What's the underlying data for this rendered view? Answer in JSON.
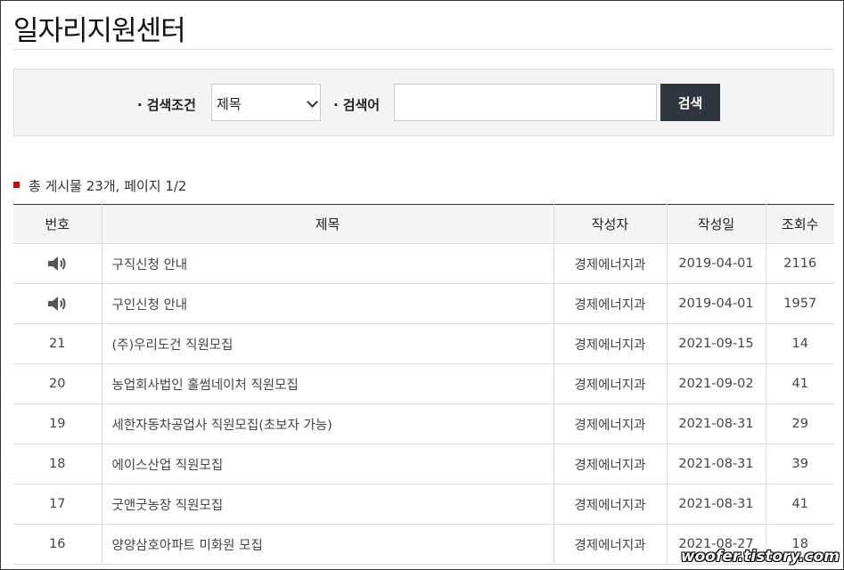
{
  "page_title": "일자리지원센터",
  "search": {
    "condition_label": "검색조건",
    "condition_selected": "제목",
    "keyword_label": "검색어",
    "keyword_value": "",
    "button_label": "검색"
  },
  "summary": "총 게시물 23개, 페이지 1/2",
  "table": {
    "headers": [
      "번호",
      "제목",
      "작성자",
      "작성일",
      "조회수"
    ],
    "rows": [
      {
        "num": "",
        "notice": true,
        "title": "구직신청 안내",
        "author": "경제에너지과",
        "date": "2019-04-01",
        "views": "2116"
      },
      {
        "num": "",
        "notice": true,
        "title": "구인신청 안내",
        "author": "경제에너지과",
        "date": "2019-04-01",
        "views": "1957"
      },
      {
        "num": "21",
        "notice": false,
        "title": "(주)우리도건 직원모집",
        "author": "경제에너지과",
        "date": "2021-09-15",
        "views": "14"
      },
      {
        "num": "20",
        "notice": false,
        "title": "농업회사법인 홀썸네이처 직원모집",
        "author": "경제에너지과",
        "date": "2021-09-02",
        "views": "41"
      },
      {
        "num": "19",
        "notice": false,
        "title": "세한자동차공업사 직원모집(초보자 가능)",
        "author": "경제에너지과",
        "date": "2021-08-31",
        "views": "29"
      },
      {
        "num": "18",
        "notice": false,
        "title": "에이스산업 직원모집",
        "author": "경제에너지과",
        "date": "2021-08-31",
        "views": "39"
      },
      {
        "num": "17",
        "notice": false,
        "title": "굿앤굿농장 직원모집",
        "author": "경제에너지과",
        "date": "2021-08-31",
        "views": "41"
      },
      {
        "num": "16",
        "notice": false,
        "title": "양양삼호아파트 미화원 모집",
        "author": "경제에너지과",
        "date": "2021-08-27",
        "views": "18"
      }
    ]
  },
  "watermark": "woofer.tistory.com"
}
